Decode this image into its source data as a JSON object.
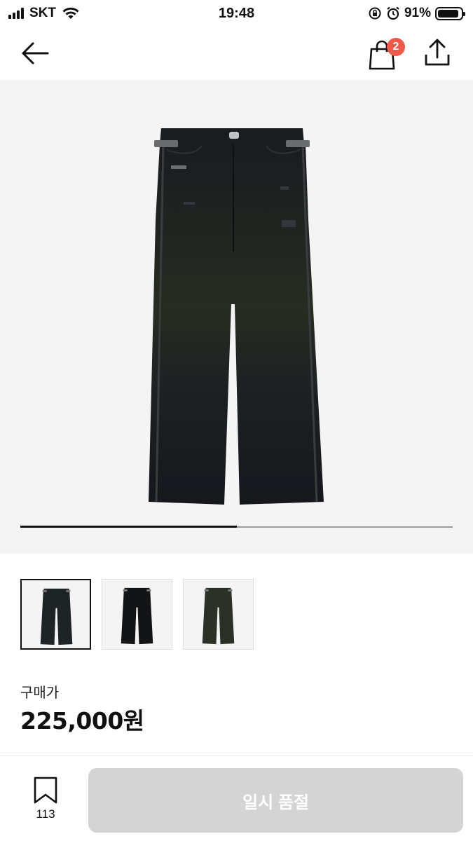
{
  "status_bar": {
    "carrier": "SKT",
    "time": "19:48",
    "battery_percent": "91%",
    "battery_level": 0.91
  },
  "nav": {
    "back_icon": "arrow-left-icon",
    "cart_icon": "shopping-bag-icon",
    "cart_badge": "2",
    "share_icon": "share-upload-icon"
  },
  "gallery": {
    "progress": 0.5,
    "selected_index": 0,
    "thumbnails": [
      {
        "variant": "washed-black",
        "selected": true
      },
      {
        "variant": "black",
        "selected": false
      },
      {
        "variant": "olive-black",
        "selected": false
      }
    ]
  },
  "price": {
    "label": "구매가",
    "value": "225,000원"
  },
  "bottom_bar": {
    "wishlist_icon": "bookmark-icon",
    "wishlist_count": "113",
    "buy_label": "일시 품절"
  },
  "colors": {
    "badge": "#f05a4b",
    "disabled_button": "#d4d4d4",
    "image_background": "#f4f4f4"
  }
}
